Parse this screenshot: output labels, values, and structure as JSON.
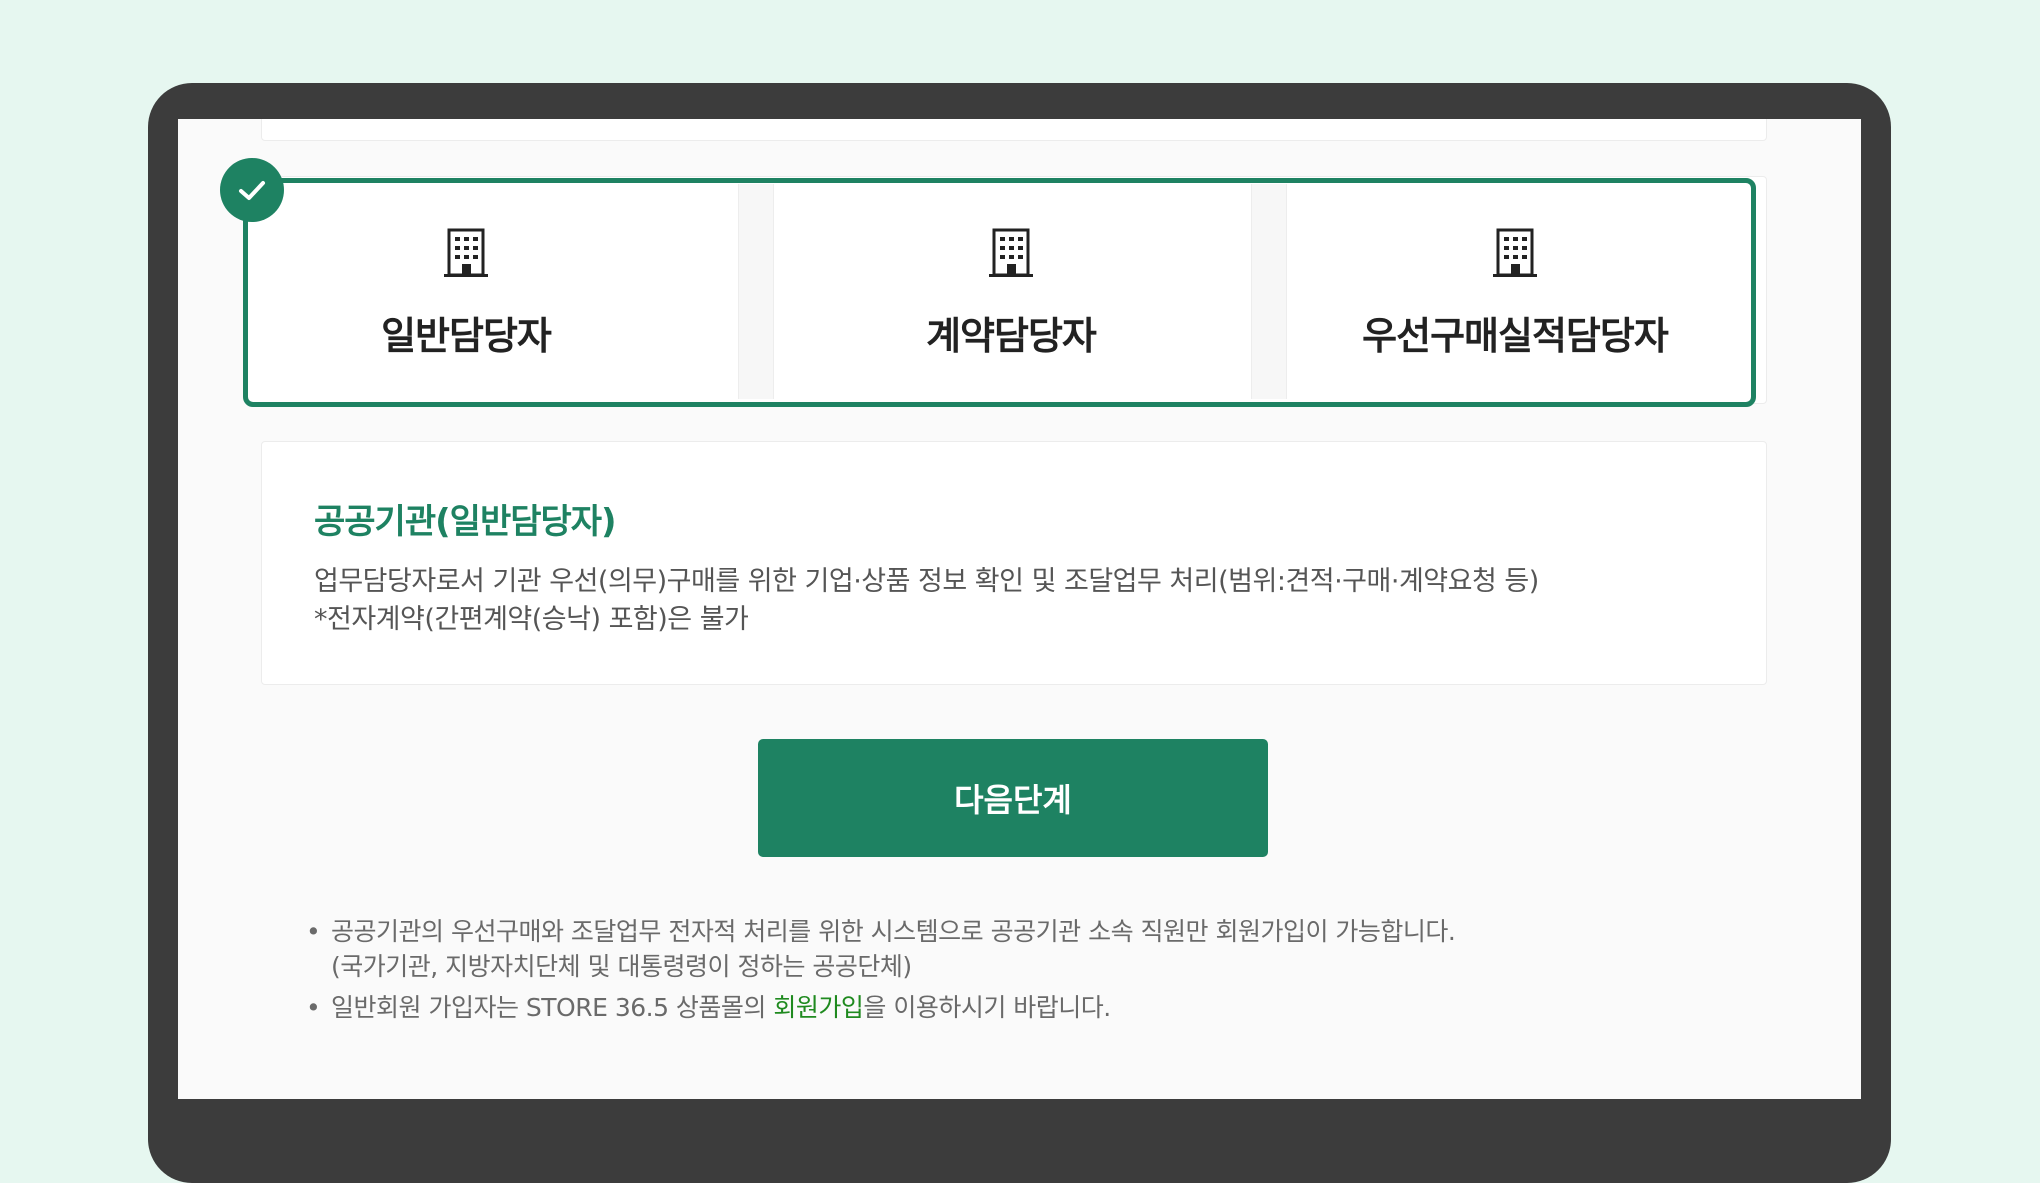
{
  "options": [
    {
      "label": "일반담당자",
      "icon": "building-icon"
    },
    {
      "label": "계약담당자",
      "icon": "building-icon"
    },
    {
      "label": "우선구매실적담당자",
      "icon": "building-icon"
    }
  ],
  "selected": {
    "icon": "check-icon"
  },
  "description": {
    "title": "공공기관(일반담당자)",
    "line1": "업무담당자로서 기관 우선(의무)구매를 위한 기업·상품 정보 확인 및 조달업무 처리(범위:견적·구매·계약요청 등)",
    "line2": "*전자계약(간편계약(승낙) 포함)은 불가"
  },
  "next_button": "다음단계",
  "notes": {
    "bullet": "•",
    "note1_line1": "공공기관의 우선구매와 조달업무 전자적 처리를 위한 시스템으로 공공기관 소속 직원만 회원가입이 가능합니다.",
    "note1_line2": "(국가기관, 지방자치단체 및 대통령령이 정하는 공공단체)",
    "note2_before": "일반회원 가입자는 STORE 36.5 상품몰의 ",
    "note2_link": "회원가입",
    "note2_after": "을 이용하시기 바랍니다."
  },
  "colors": {
    "accent": "#1e8262",
    "background": "#e6f7f0",
    "link": "#1f8a1f"
  }
}
